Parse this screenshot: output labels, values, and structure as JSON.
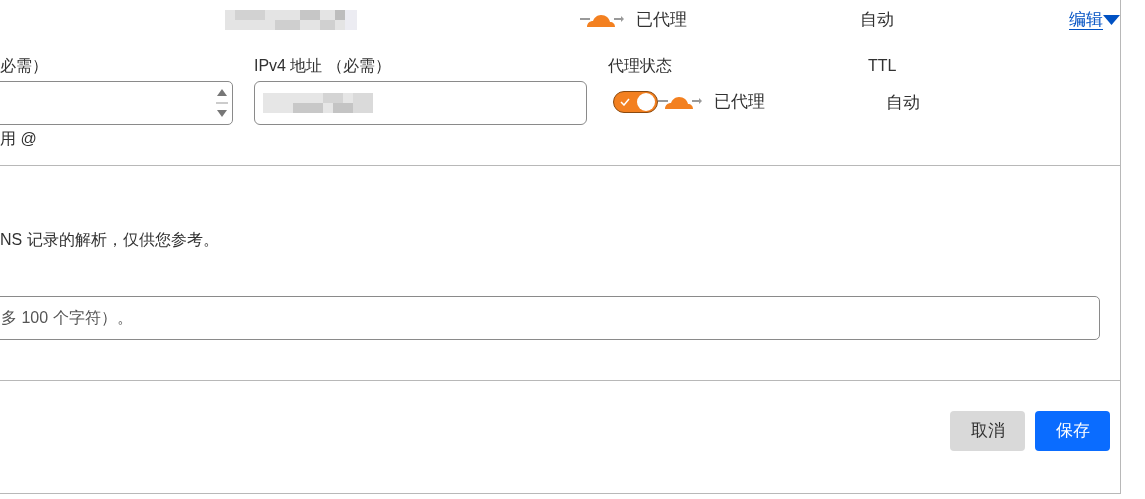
{
  "summary_row": {
    "proxy": {
      "proxied": true,
      "label": "已代理"
    },
    "ttl": "自动",
    "edit_link": "编辑"
  },
  "form": {
    "name_field": {
      "label": "必需）",
      "hint": "用 @"
    },
    "ipv4_field": {
      "label": "IPv4 地址 （必需）"
    },
    "proxy": {
      "label": "代理状态",
      "on": true,
      "status": "已代理"
    },
    "ttl": {
      "label": "TTL",
      "value": "自动"
    }
  },
  "note": "NS 记录的解析，仅供您参考。",
  "comment_field": {
    "placeholder": "多 100 个字符）。"
  },
  "buttons": [
    {
      "label": "取消",
      "kind": "secondary"
    },
    {
      "label": "保存",
      "kind": "primary"
    }
  ]
}
